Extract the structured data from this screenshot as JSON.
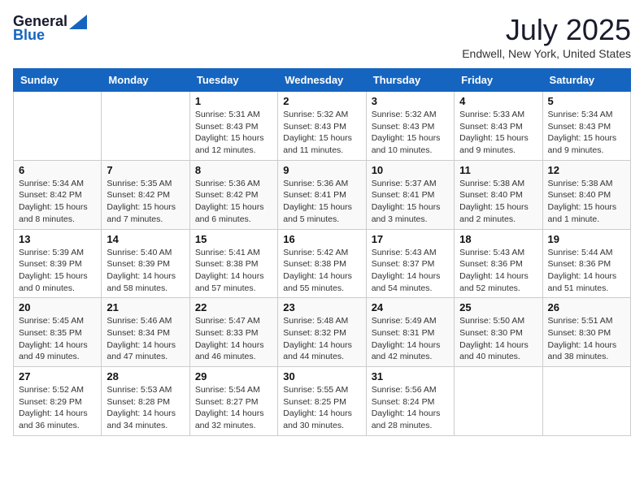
{
  "header": {
    "logo_general": "General",
    "logo_blue": "Blue",
    "month_title": "July 2025",
    "location": "Endwell, New York, United States"
  },
  "days_of_week": [
    "Sunday",
    "Monday",
    "Tuesday",
    "Wednesday",
    "Thursday",
    "Friday",
    "Saturday"
  ],
  "weeks": [
    [
      {
        "day": "",
        "info": ""
      },
      {
        "day": "",
        "info": ""
      },
      {
        "day": "1",
        "info": "Sunrise: 5:31 AM\nSunset: 8:43 PM\nDaylight: 15 hours and 12 minutes."
      },
      {
        "day": "2",
        "info": "Sunrise: 5:32 AM\nSunset: 8:43 PM\nDaylight: 15 hours and 11 minutes."
      },
      {
        "day": "3",
        "info": "Sunrise: 5:32 AM\nSunset: 8:43 PM\nDaylight: 15 hours and 10 minutes."
      },
      {
        "day": "4",
        "info": "Sunrise: 5:33 AM\nSunset: 8:43 PM\nDaylight: 15 hours and 9 minutes."
      },
      {
        "day": "5",
        "info": "Sunrise: 5:34 AM\nSunset: 8:43 PM\nDaylight: 15 hours and 9 minutes."
      }
    ],
    [
      {
        "day": "6",
        "info": "Sunrise: 5:34 AM\nSunset: 8:42 PM\nDaylight: 15 hours and 8 minutes."
      },
      {
        "day": "7",
        "info": "Sunrise: 5:35 AM\nSunset: 8:42 PM\nDaylight: 15 hours and 7 minutes."
      },
      {
        "day": "8",
        "info": "Sunrise: 5:36 AM\nSunset: 8:42 PM\nDaylight: 15 hours and 6 minutes."
      },
      {
        "day": "9",
        "info": "Sunrise: 5:36 AM\nSunset: 8:41 PM\nDaylight: 15 hours and 5 minutes."
      },
      {
        "day": "10",
        "info": "Sunrise: 5:37 AM\nSunset: 8:41 PM\nDaylight: 15 hours and 3 minutes."
      },
      {
        "day": "11",
        "info": "Sunrise: 5:38 AM\nSunset: 8:40 PM\nDaylight: 15 hours and 2 minutes."
      },
      {
        "day": "12",
        "info": "Sunrise: 5:38 AM\nSunset: 8:40 PM\nDaylight: 15 hours and 1 minute."
      }
    ],
    [
      {
        "day": "13",
        "info": "Sunrise: 5:39 AM\nSunset: 8:39 PM\nDaylight: 15 hours and 0 minutes."
      },
      {
        "day": "14",
        "info": "Sunrise: 5:40 AM\nSunset: 8:39 PM\nDaylight: 14 hours and 58 minutes."
      },
      {
        "day": "15",
        "info": "Sunrise: 5:41 AM\nSunset: 8:38 PM\nDaylight: 14 hours and 57 minutes."
      },
      {
        "day": "16",
        "info": "Sunrise: 5:42 AM\nSunset: 8:38 PM\nDaylight: 14 hours and 55 minutes."
      },
      {
        "day": "17",
        "info": "Sunrise: 5:43 AM\nSunset: 8:37 PM\nDaylight: 14 hours and 54 minutes."
      },
      {
        "day": "18",
        "info": "Sunrise: 5:43 AM\nSunset: 8:36 PM\nDaylight: 14 hours and 52 minutes."
      },
      {
        "day": "19",
        "info": "Sunrise: 5:44 AM\nSunset: 8:36 PM\nDaylight: 14 hours and 51 minutes."
      }
    ],
    [
      {
        "day": "20",
        "info": "Sunrise: 5:45 AM\nSunset: 8:35 PM\nDaylight: 14 hours and 49 minutes."
      },
      {
        "day": "21",
        "info": "Sunrise: 5:46 AM\nSunset: 8:34 PM\nDaylight: 14 hours and 47 minutes."
      },
      {
        "day": "22",
        "info": "Sunrise: 5:47 AM\nSunset: 8:33 PM\nDaylight: 14 hours and 46 minutes."
      },
      {
        "day": "23",
        "info": "Sunrise: 5:48 AM\nSunset: 8:32 PM\nDaylight: 14 hours and 44 minutes."
      },
      {
        "day": "24",
        "info": "Sunrise: 5:49 AM\nSunset: 8:31 PM\nDaylight: 14 hours and 42 minutes."
      },
      {
        "day": "25",
        "info": "Sunrise: 5:50 AM\nSunset: 8:30 PM\nDaylight: 14 hours and 40 minutes."
      },
      {
        "day": "26",
        "info": "Sunrise: 5:51 AM\nSunset: 8:30 PM\nDaylight: 14 hours and 38 minutes."
      }
    ],
    [
      {
        "day": "27",
        "info": "Sunrise: 5:52 AM\nSunset: 8:29 PM\nDaylight: 14 hours and 36 minutes."
      },
      {
        "day": "28",
        "info": "Sunrise: 5:53 AM\nSunset: 8:28 PM\nDaylight: 14 hours and 34 minutes."
      },
      {
        "day": "29",
        "info": "Sunrise: 5:54 AM\nSunset: 8:27 PM\nDaylight: 14 hours and 32 minutes."
      },
      {
        "day": "30",
        "info": "Sunrise: 5:55 AM\nSunset: 8:25 PM\nDaylight: 14 hours and 30 minutes."
      },
      {
        "day": "31",
        "info": "Sunrise: 5:56 AM\nSunset: 8:24 PM\nDaylight: 14 hours and 28 minutes."
      },
      {
        "day": "",
        "info": ""
      },
      {
        "day": "",
        "info": ""
      }
    ]
  ]
}
